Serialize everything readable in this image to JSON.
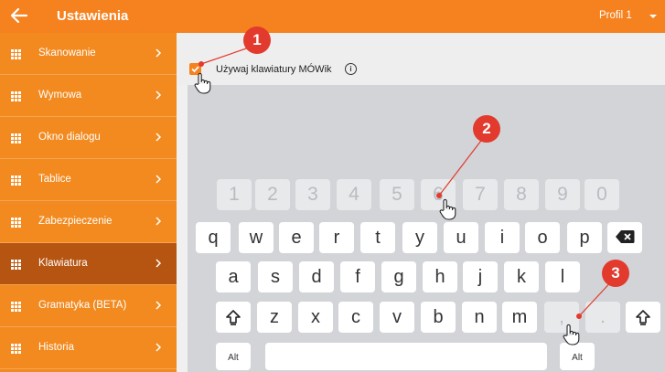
{
  "header": {
    "title": "Ustawienia",
    "profile": "Profil 1",
    "back_icon": "arrow-left-icon",
    "background": "#f5821f"
  },
  "sidebar": {
    "items": [
      {
        "label": "Skanowanie",
        "active": false
      },
      {
        "label": "Wymowa",
        "active": false
      },
      {
        "label": "Okno dialogu",
        "active": false
      },
      {
        "label": "Tablice",
        "active": false
      },
      {
        "label": "Zabezpieczenie",
        "active": false
      },
      {
        "label": "Klawiatura",
        "active": true
      },
      {
        "label": "Gramatyka (BETA)",
        "active": false
      },
      {
        "label": "Historia",
        "active": false
      }
    ],
    "colors": {
      "item": "#f28a1f",
      "active": "#b65512"
    }
  },
  "settings": {
    "keyboard_checkbox_label": "Używaj klawiatury MÓWik",
    "keyboard_checkbox_checked": true,
    "info_icon": "info-circle-icon"
  },
  "keyboard": {
    "number_row": [
      "1",
      "2",
      "3",
      "4",
      "5",
      "6",
      "7",
      "8",
      "9",
      "0"
    ],
    "row1": [
      "q",
      "w",
      "e",
      "r",
      "t",
      "y",
      "u",
      "i",
      "o",
      "p"
    ],
    "row2": [
      "a",
      "s",
      "d",
      "f",
      "g",
      "h",
      "j",
      "k",
      "l"
    ],
    "row3": [
      "z",
      "x",
      "c",
      "v",
      "b",
      "n",
      "m",
      ",",
      "."
    ],
    "alt_left": "Alt",
    "alt_right": "Alt",
    "backspace_icon": "backspace-icon",
    "shift_icon": "shift-icon"
  },
  "annotations": {
    "badges": [
      "1",
      "2",
      "3"
    ],
    "color": "#e23a2d",
    "pointer_icon": "hand-pointer-icon"
  }
}
